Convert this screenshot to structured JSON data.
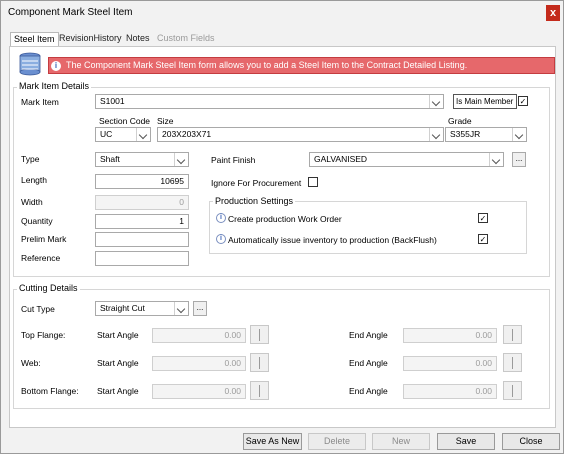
{
  "window": {
    "title": "Component Mark Steel Item",
    "close_glyph": "x"
  },
  "tabs": [
    {
      "label": "Steel Item",
      "state": "active"
    },
    {
      "label": "RevisionHistory",
      "state": "inactive"
    },
    {
      "label": "Notes",
      "state": "inactive"
    },
    {
      "label": "Custom Fields",
      "state": "disabled"
    }
  ],
  "banner": {
    "text": "The Component Mark Steel Item form allows you to add a Steel Item to the Contract Detailed Listing.",
    "color": "#e6686b"
  },
  "mark_item_details": {
    "title": "Mark Item Details",
    "mark_item_label": "Mark Item",
    "mark_item_value": "S1001",
    "is_main_member_label": "Is Main Member",
    "is_main_member_checked": true,
    "section_code_label": "Section Code",
    "section_code_value": "UC",
    "size_label": "Size",
    "size_value": "203X203X71",
    "grade_label": "Grade",
    "grade_value": "S355JR",
    "type_label": "Type",
    "type_value": "Shaft",
    "length_label": "Length",
    "length_value": "10695",
    "width_label": "Width",
    "width_value": "0",
    "quantity_label": "Quantity",
    "quantity_value": "1",
    "prelim_mark_label": "Prelim Mark",
    "prelim_mark_value": "",
    "reference_label": "Reference",
    "reference_value": "",
    "paint_finish_label": "Paint Finish",
    "paint_finish_value": "GALVANISED",
    "ignore_procurement_label": "Ignore For Procurement",
    "ignore_procurement_checked": false,
    "production_settings": {
      "title": "Production Settings",
      "create_work_order_label": "Create production Work Order",
      "create_work_order_checked": true,
      "backflush_label": "Automatically issue inventory to production (BackFlush)",
      "backflush_checked": true
    }
  },
  "cutting_details": {
    "title": "Cutting Details",
    "cut_type_label": "Cut Type",
    "cut_type_value": "Straight Cut",
    "rows": [
      {
        "label": "Top Flange:",
        "start_label": "Start Angle",
        "start_value": "0.00",
        "end_label": "End Angle",
        "end_value": "0.00"
      },
      {
        "label": "Web:",
        "start_label": "Start Angle",
        "start_value": "0.00",
        "end_label": "End Angle",
        "end_value": "0.00"
      },
      {
        "label": "Bottom Flange:",
        "start_label": "Start Angle",
        "start_value": "0.00",
        "end_label": "End Angle",
        "end_value": "0.00"
      }
    ]
  },
  "buttons": {
    "save_as_new": "Save As New",
    "delete": "Delete",
    "new": "New",
    "save": "Save",
    "close": "Close"
  },
  "glyphs": {
    "check": "✓",
    "ellipsis": "...",
    "info": "i"
  }
}
